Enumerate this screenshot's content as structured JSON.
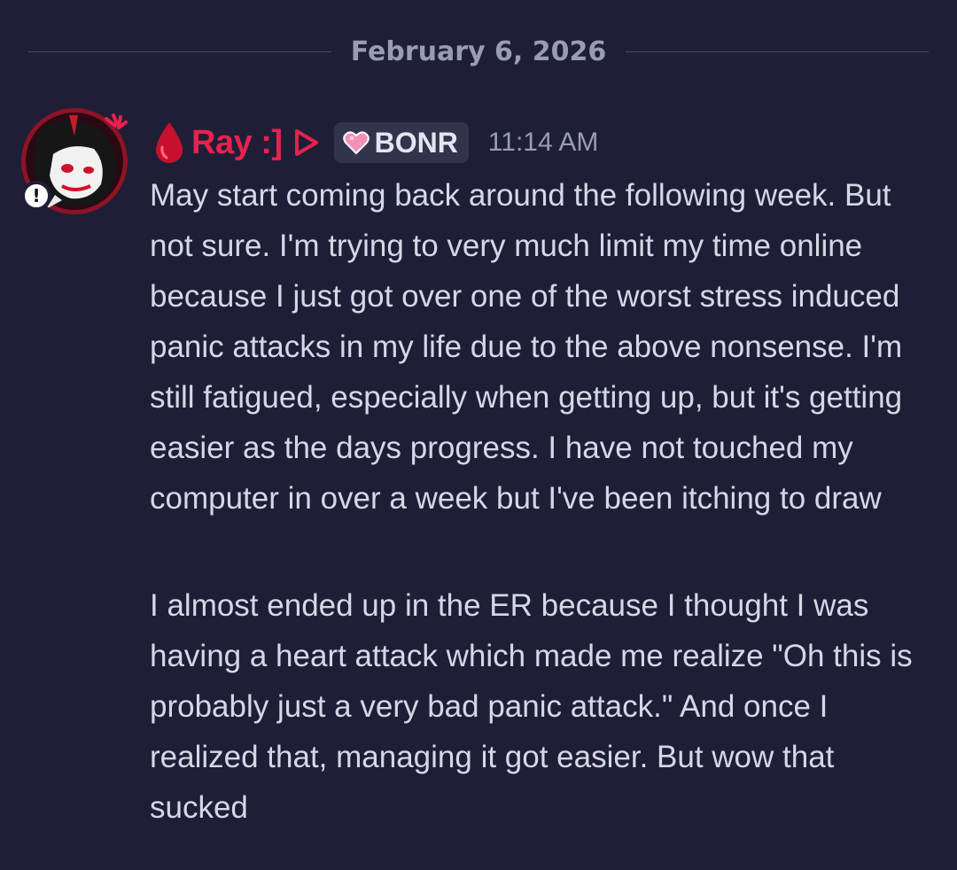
{
  "date_divider": "February 6, 2026",
  "author": {
    "name": "Ray :]",
    "name_color": "#e8214f",
    "prefix_icon": "blood-drop-icon",
    "suffix_icon": "play-triangle-icon",
    "status_icon": "exclamation-icon"
  },
  "tag": {
    "icon": "pink-heart-icon",
    "label": "BONR"
  },
  "timestamp": "11:14 AM",
  "messages": [
    "May start coming back around the following week. But not sure. I'm trying to very much limit my time online because I just got over one of the worst stress induced panic attacks in my life due to the above nonsense. I'm still fatigued, especially when getting up, but it's getting easier as the days progress. I have not touched my computer in over a week but I've been itching to draw",
    "I almost ended up in the ER because I thought I was having a heart attack which made me realize \"Oh this is probably just a very bad panic attack.\" And once I realized that, managing it got easier. But wow that sucked"
  ],
  "colors": {
    "background": "#1e1f37",
    "text": "#d6d7e6",
    "muted": "#9a9cb3",
    "tag_background": "#32344d"
  }
}
